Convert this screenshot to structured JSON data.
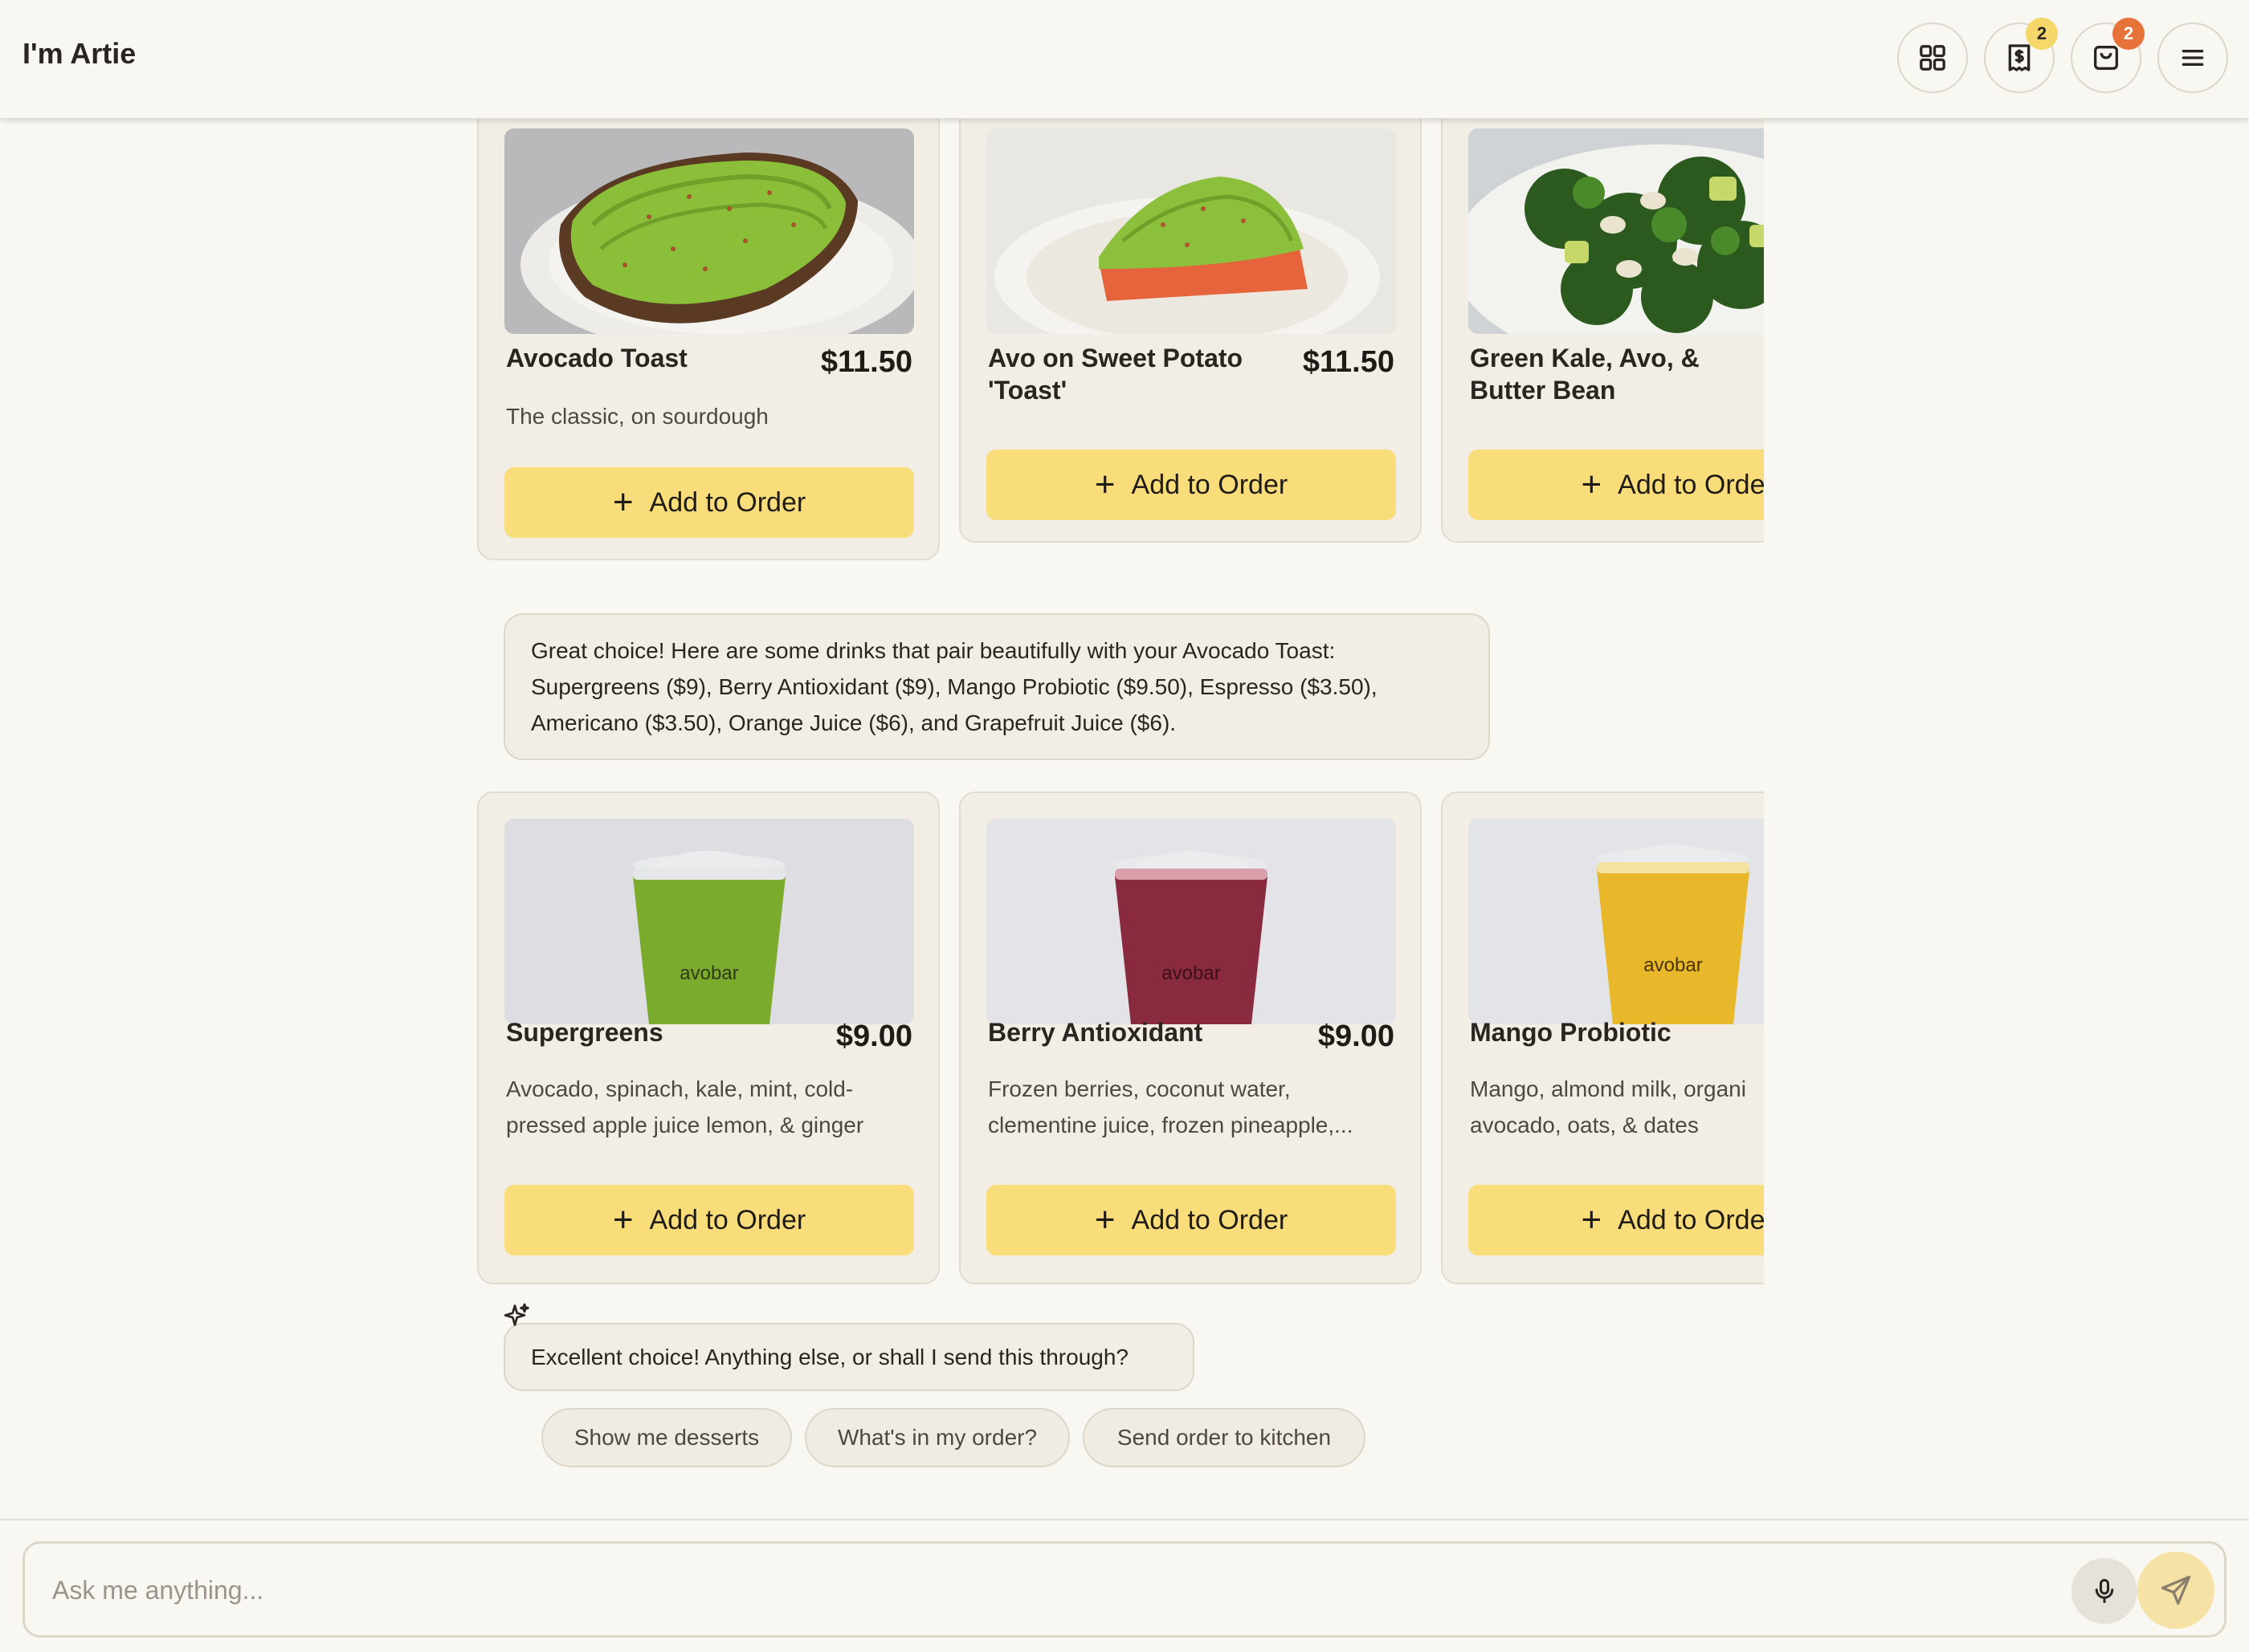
{
  "app": {
    "title": "I'm Artie"
  },
  "header": {
    "menu_grid_icon": "grid-icon",
    "receipt_badge": "2",
    "cart_badge": "2",
    "colors": {
      "receipt_badge": "#f6d76a",
      "cart_badge": "#e8733a"
    }
  },
  "food_cards": [
    {
      "name": "Avocado Toast",
      "price": "$11.50",
      "description": "The classic, on sourdough",
      "button": "Add to Order"
    },
    {
      "name": "Avo on Sweet Potato 'Toast'",
      "price": "$11.50",
      "description": "",
      "button": "Add to Order"
    },
    {
      "name": "Green Kale, Avo, & Butter Bean",
      "price": "",
      "description": "",
      "button": "Add to Orde"
    }
  ],
  "messages": [
    {
      "text": "Great choice! Here are some drinks that pair beautifully with your Avocado Toast: Supergreens ($9), Berry Antioxidant ($9), Mango Probiotic ($9.50), Espresso ($3.50), Americano ($3.50), Orange Juice ($6), and Grapefruit Juice ($6)."
    },
    {
      "text": "Excellent choice! Anything else, or shall I send this through?"
    }
  ],
  "drink_cards": [
    {
      "name": "Supergreens",
      "price": "$9.00",
      "desc_line1": "Avocado, spinach, kale, mint, cold-",
      "desc_line2": "pressed apple juice lemon, & ginger",
      "button": "Add to Order",
      "cup_label": "avobar",
      "cup_color": "#7bab2c"
    },
    {
      "name": "Berry Antioxidant",
      "price": "$9.00",
      "desc_line1": "Frozen berries, coconut water,",
      "desc_line2": "clementine juice, frozen pineapple,...",
      "button": "Add to Order",
      "cup_label": "avobar",
      "cup_color": "#8a2a3e"
    },
    {
      "name": "Mango Probiotic",
      "price": "",
      "desc_line1": "Mango, almond milk, organi",
      "desc_line2": "avocado, oats, & dates",
      "button": "Add to Orde",
      "cup_label": "avobar",
      "cup_color": "#e9b82a"
    }
  ],
  "suggestions": [
    "Show me desserts",
    "What's in my order?",
    "Send order to kitchen"
  ],
  "composer": {
    "placeholder": "Ask me anything..."
  },
  "accent": {
    "button_yellow": "#f9dd7b"
  }
}
